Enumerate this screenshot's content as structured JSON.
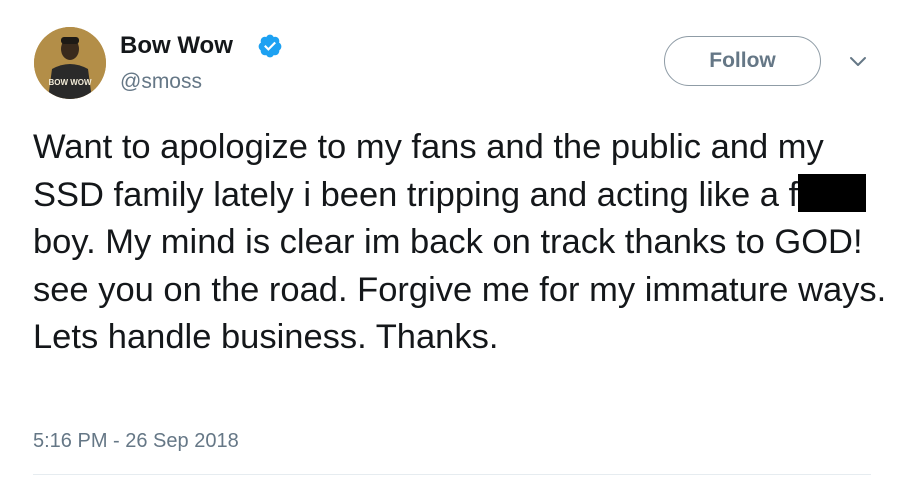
{
  "user": {
    "display_name": "Bow Wow",
    "handle": "@smoss",
    "avatar_caption": "BOW WOW",
    "verified": true
  },
  "actions": {
    "follow_label": "Follow",
    "menu_icon": "chevron-down-icon"
  },
  "tweet": {
    "text_part1": "Want to apologize to my fans and the public and my SSD family lately i been tripping and acting like a f",
    "text_part2": "boy. My mind is clear im back on track thanks to GOD! see you on the road. Forgive me for my immature ways. Lets handle business. Thanks.",
    "timestamp": "5:16 PM - 26 Sep 2018"
  },
  "colors": {
    "text": "#14171a",
    "secondary": "#657786",
    "verified_blue": "#1da1f2",
    "divider": "#e6ecf0"
  }
}
